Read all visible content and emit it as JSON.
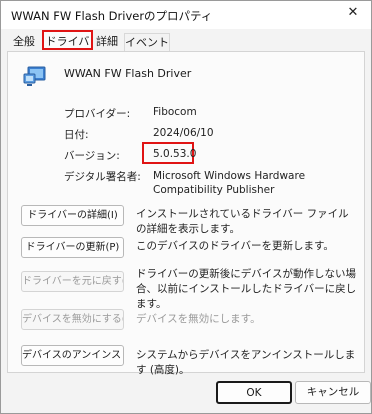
{
  "window": {
    "title": "WWAN FW Flash Driverのプロパティ",
    "close_glyph": "✕"
  },
  "tabs": [
    {
      "label": "全般"
    },
    {
      "label": "ドライバー",
      "selected": true
    },
    {
      "label": "詳細"
    },
    {
      "label": "イベント"
    }
  ],
  "device": {
    "name": "WWAN FW Flash Driver",
    "icon": "network-adapter-icon"
  },
  "properties": [
    {
      "label": "プロバイダー:",
      "value": "Fibocom"
    },
    {
      "label": "日付:",
      "value": "2024/06/10"
    },
    {
      "label": "バージョン:",
      "value": "5.0.53.0"
    },
    {
      "label": "デジタル署名者:",
      "value": "Microsoft Windows Hardware Compatibility Publisher"
    }
  ],
  "actions": [
    {
      "button": "ドライバーの詳細(I)",
      "description": "インストールされているドライバー ファイルの詳細を表示します。",
      "enabled": true
    },
    {
      "button": "ドライバーの更新(P)",
      "description": "このデバイスのドライバーを更新します。",
      "enabled": true
    },
    {
      "button": "ドライバーを元に戻す(R)",
      "description": "ドライバーの更新後にデバイスが動作しない場合、以前にインストールしたドライバーに戻します。",
      "enabled": false
    },
    {
      "button": "デバイスを無効にする(D)",
      "description": "デバイスを無効にします。",
      "enabled": false
    },
    {
      "button": "デバイスのアンインストール(U)",
      "description": "システムからデバイスをアンインストールします (高度)。",
      "enabled": true
    }
  ],
  "footer": {
    "ok_label": "OK",
    "cancel_label": "キャンセル"
  },
  "colors": {
    "highlight": "#e01414"
  }
}
